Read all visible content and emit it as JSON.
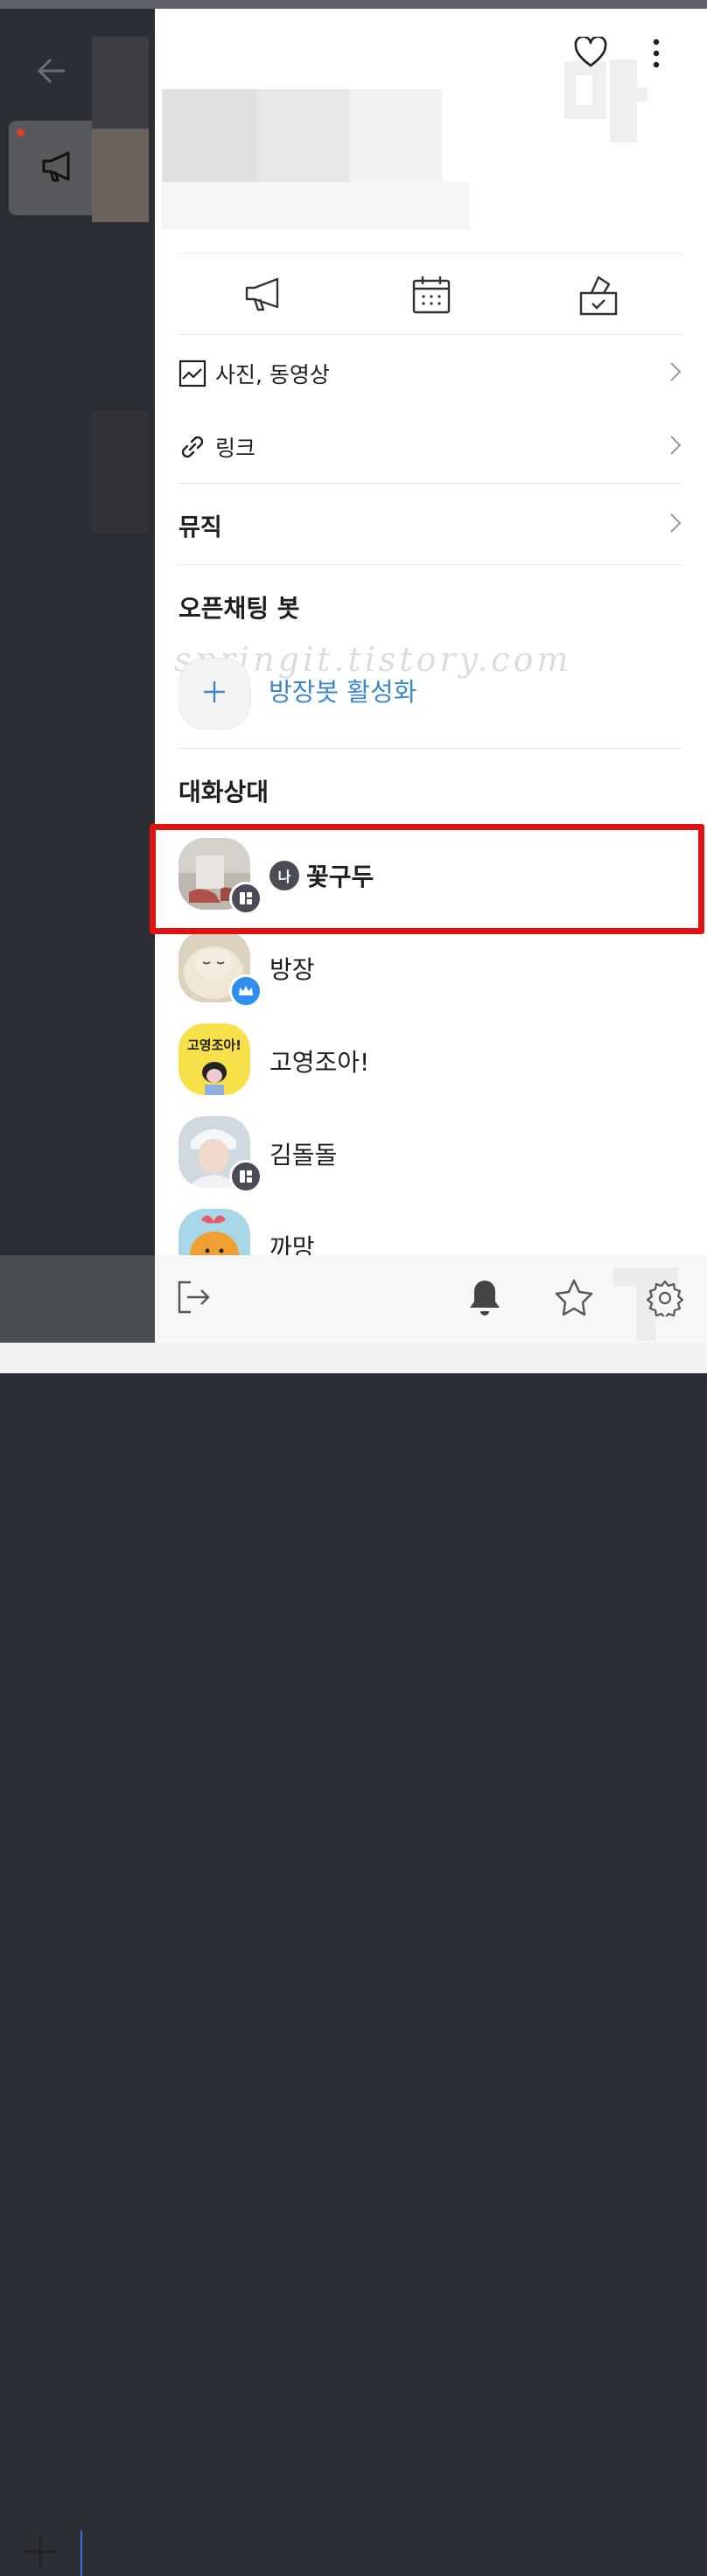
{
  "drawer": {
    "menu": {
      "photos_label": "사진, 동영상",
      "links_label": "링크",
      "music_label": "뮤직"
    },
    "openchat_bot": {
      "title": "오픈채팅 봇",
      "activate_label": "방장봇 활성화"
    },
    "watermark": "springit.tistory.com",
    "members": {
      "title": "대화상대",
      "me_badge": "나",
      "list": [
        {
          "name": "꽃구두",
          "role": "me"
        },
        {
          "name": "방장",
          "role": "host"
        },
        {
          "name": "고영조아!",
          "role": "member",
          "avatar_text": "고영조아!"
        },
        {
          "name": "김돌돌",
          "role": "member"
        },
        {
          "name": "까망",
          "role": "member"
        }
      ]
    }
  },
  "colors": {
    "highlight": "#e01212",
    "link_blue": "#3c87c9",
    "dim_background": "#2b2e34"
  }
}
